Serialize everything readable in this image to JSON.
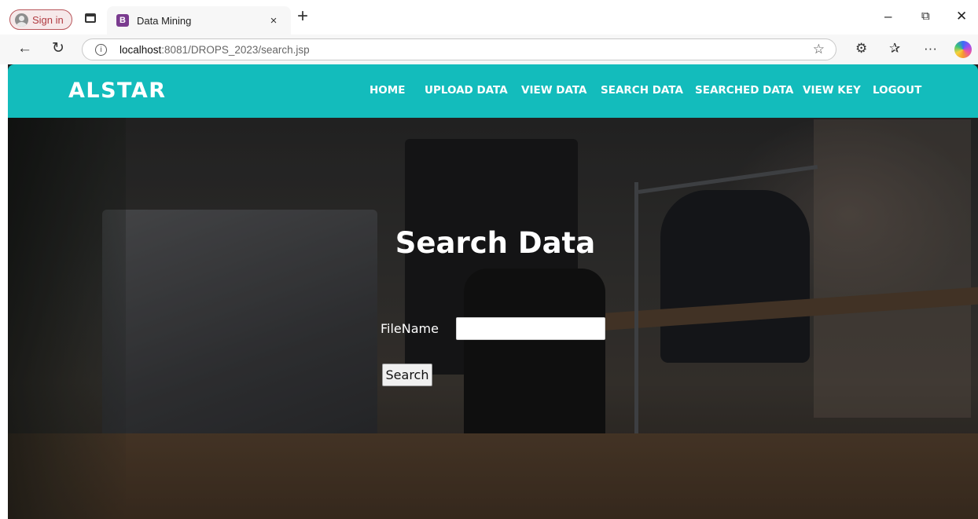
{
  "browser": {
    "signin_label": "Sign in",
    "tab": {
      "favicon_letter": "B",
      "title": "Data Mining",
      "close": "×"
    },
    "newtab": "+",
    "window_controls": {
      "minimize": "–",
      "restore": "⧉",
      "close": "✕"
    },
    "nav": {
      "back": "←",
      "reload": "↻"
    },
    "url": {
      "info": "i",
      "host": "localhost",
      "path": ":8081/DROPS_2023/search.jsp",
      "favorite": "☆"
    },
    "toolbar": {
      "extensions": "⚙",
      "favorites": "✰",
      "more": "···"
    }
  },
  "site": {
    "brand": "ALSTAR",
    "nav_color": "#13bcbc",
    "menu": [
      "HOME",
      "UPLOAD DATA",
      "VIEW DATA",
      "SEARCH DATA",
      "SEARCHED DATA",
      "VIEW KEY",
      "LOGOUT"
    ],
    "heading": "Search Data",
    "form": {
      "filename_label": "FileName",
      "filename_value": "",
      "submit_label": "Search"
    }
  }
}
